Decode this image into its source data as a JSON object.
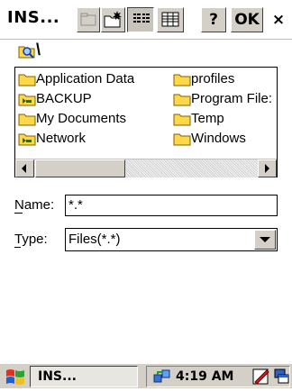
{
  "titlebar": {
    "title": "INS...",
    "help_label": "?",
    "ok_label": "OK",
    "close_label": "×"
  },
  "path": {
    "text": "\\"
  },
  "list": {
    "items": [
      {
        "label": "Application Data",
        "icon": "folder-icon"
      },
      {
        "label": "BACKUP",
        "icon": "folder-shared-icon"
      },
      {
        "label": "My Documents",
        "icon": "folder-icon"
      },
      {
        "label": "Network",
        "icon": "folder-shared-icon"
      },
      {
        "label": "profiles",
        "icon": "folder-icon"
      },
      {
        "label": "Program File:",
        "icon": "folder-icon"
      },
      {
        "label": "Temp",
        "icon": "folder-icon"
      },
      {
        "label": "Windows",
        "icon": "folder-icon"
      }
    ]
  },
  "form": {
    "name_label": "Name:",
    "name_value": "*.*",
    "type_label": "Type:",
    "type_value": "Files(*.*)"
  },
  "taskbar": {
    "task_label": "INS...",
    "time": "4:19 AM"
  },
  "colors": {
    "folder": "#ffd84a",
    "chrome": "#d4d0c8"
  }
}
